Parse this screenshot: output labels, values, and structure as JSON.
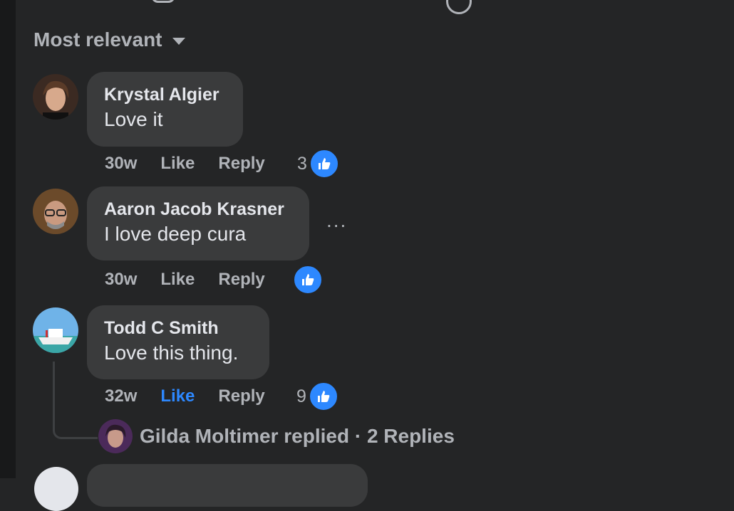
{
  "sort": {
    "label": "Most relevant"
  },
  "comments": [
    {
      "author": "Krystal Algier",
      "text": "Love it",
      "time": "30w",
      "like_label": "Like",
      "reply_label": "Reply",
      "reaction_count": "3"
    },
    {
      "author": "Aaron Jacob Krasner",
      "text": "I love deep cura",
      "time": "30w",
      "like_label": "Like",
      "reply_label": "Reply",
      "more_label": "..."
    },
    {
      "author": "Todd C Smith",
      "text": "Love this thing.",
      "time": "32w",
      "like_label": "Like",
      "reply_label": "Reply",
      "reaction_count": "9",
      "liked": true,
      "replies_summary": "Gilda Moltimer replied · 2 Replies"
    }
  ],
  "colors": {
    "background": "#242526",
    "bubble": "#3a3b3c",
    "accent": "#2d88ff",
    "muted": "#b0b3b8"
  },
  "icons": [
    "chevron-down-icon",
    "like-thumb-icon",
    "more-options-icon"
  ]
}
